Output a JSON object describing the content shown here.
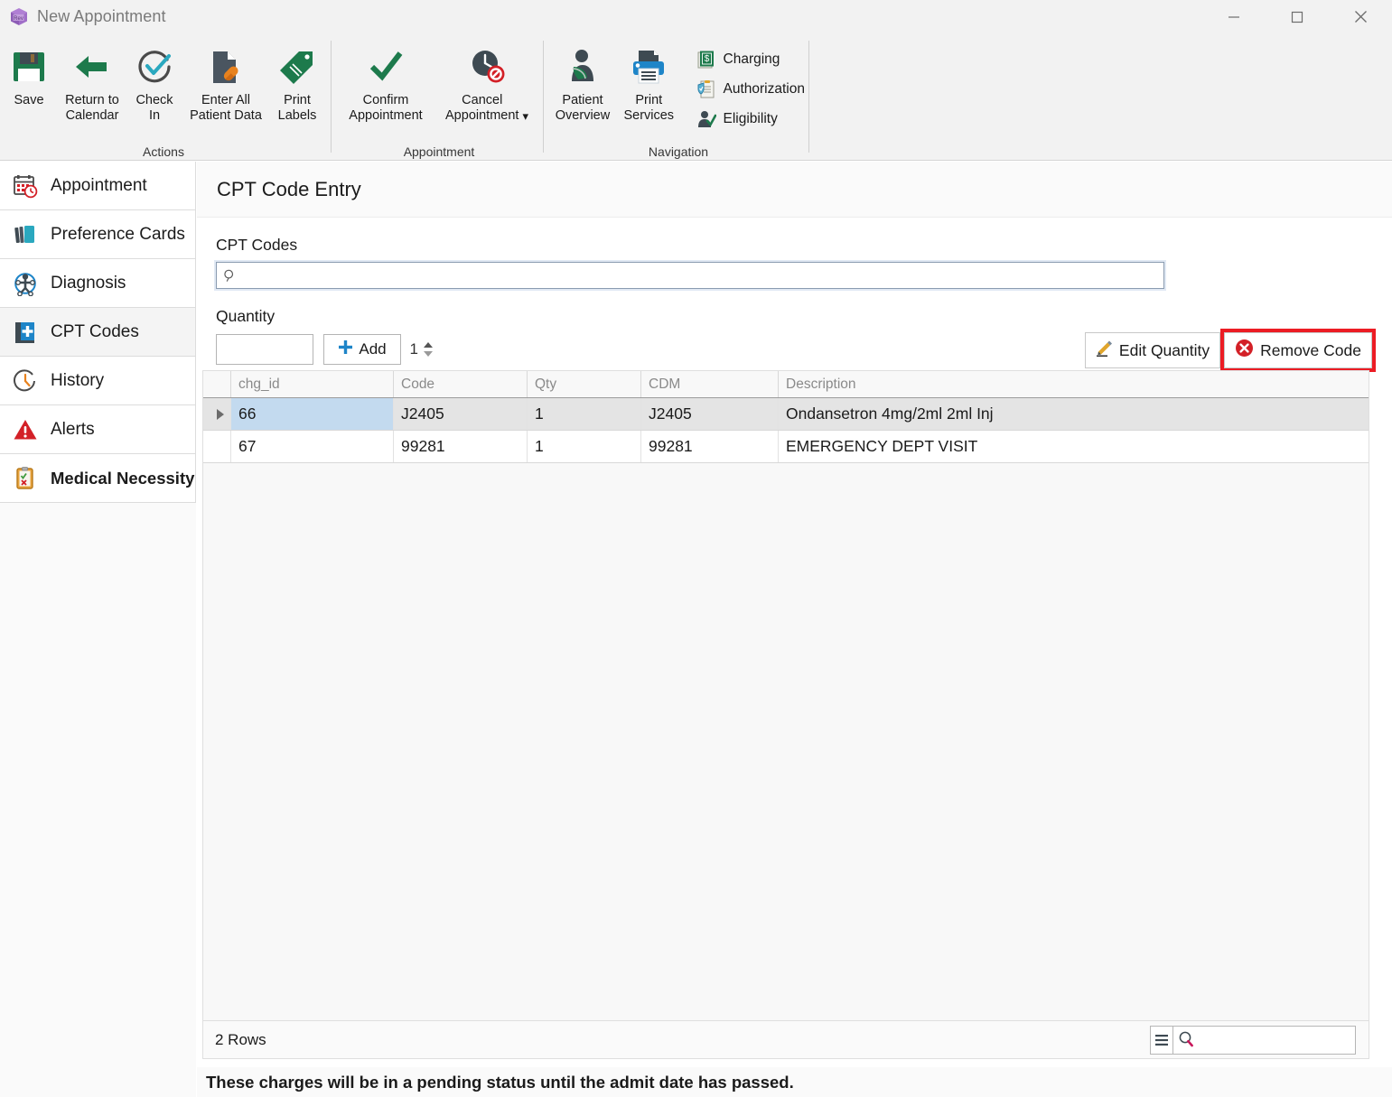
{
  "window": {
    "title": "New Appointment",
    "icon": "app-cube-icon",
    "controls": {
      "minimize": "minimize-icon",
      "maximize": "maximize-icon",
      "close": "close-icon"
    }
  },
  "ribbon": {
    "groups": [
      {
        "title": "Actions",
        "buttons": [
          {
            "label": "Save",
            "icon": "floppy-disk-save-icon"
          },
          {
            "label": "Return to\nCalendar",
            "icon": "left-arrow-icon"
          },
          {
            "label": "Check\nIn",
            "icon": "check-circle-icon"
          },
          {
            "label": "Enter All\nPatient Data",
            "icon": "document-pill-icon"
          },
          {
            "label": "Print\nLabels",
            "icon": "tag-label-icon"
          }
        ]
      },
      {
        "title": "Appointment",
        "buttons": [
          {
            "label": "Confirm\nAppointment",
            "icon": "green-checkmark-icon"
          },
          {
            "label": "Cancel\nAppointment",
            "icon": "clock-deny-icon",
            "has_dropdown": true
          }
        ]
      },
      {
        "title": "Navigation",
        "buttons": [
          {
            "label": "Patient\nOverview",
            "icon": "patient-sling-icon"
          },
          {
            "label": "Print\nServices",
            "icon": "printer-icon"
          }
        ],
        "small_buttons": [
          {
            "label": "Charging",
            "icon": "money-bill-icon"
          },
          {
            "label": "Authorization",
            "icon": "clipboard-shield-icon"
          },
          {
            "label": "Eligibility",
            "icon": "person-check-icon"
          }
        ]
      }
    ]
  },
  "sidebar": {
    "items": [
      {
        "label": "Appointment",
        "icon": "calendar-clock-icon",
        "active": false,
        "bold": false
      },
      {
        "label": "Preference Cards",
        "icon": "cards-icon",
        "active": false,
        "bold": false
      },
      {
        "label": "Diagnosis",
        "icon": "person-circle-icon",
        "active": false,
        "bold": false
      },
      {
        "label": "CPT Codes",
        "icon": "book-plus-icon",
        "active": true,
        "bold": false
      },
      {
        "label": "History",
        "icon": "clock-icon",
        "active": false,
        "bold": false
      },
      {
        "label": "Alerts",
        "icon": "warning-triangle-icon",
        "active": false,
        "bold": false
      },
      {
        "label": "Medical Necessity",
        "icon": "clipboard-check-x-icon",
        "active": false,
        "bold": true
      }
    ]
  },
  "main": {
    "page_title": "CPT Code Entry",
    "cpt_codes": {
      "label": "CPT Codes",
      "value": "",
      "placeholder": "",
      "icon": "search-magnifier-icon"
    },
    "quantity": {
      "label": "Quantity",
      "value": "1",
      "spinner_up": "spinner-up-icon",
      "spinner_down": "spinner-down-icon"
    },
    "add_button": {
      "label": "Add",
      "icon": "plus-icon"
    },
    "toolbar": {
      "edit_quantity": {
        "label": "Edit Quantity",
        "icon": "pencil-edit-icon"
      },
      "remove_code": {
        "label": "Remove Code",
        "icon": "red-x-circle-icon",
        "highlight_color": "#ec1c24"
      }
    },
    "grid": {
      "columns": [
        "chg_id",
        "Code",
        "Qty",
        "CDM",
        "Description"
      ],
      "rows": [
        {
          "chg_id": "66",
          "Code": "J2405",
          "Qty": "1",
          "CDM": "J2405",
          "Description": "Ondansetron 4mg/2ml 2ml Inj",
          "selected": true
        },
        {
          "chg_id": "67",
          "Code": "99281",
          "Qty": "1",
          "CDM": "99281",
          "Description": "EMERGENCY DEPT VISIT",
          "selected": false
        }
      ],
      "footer": {
        "row_count": "2 Rows",
        "menu_icon": "hamburger-menu-icon",
        "search_icon": "search-magnifier-icon",
        "search_value": "",
        "search_placeholder": ""
      }
    },
    "notice": "These charges will be in a pending status until the admit date has passed."
  },
  "colors": {
    "green": "#1d7a4c",
    "teal": "#2aa8bf",
    "blue": "#1e85c8",
    "red": "#d32027",
    "highlight_red": "#ec1c24",
    "selection_blue": "#c3daef",
    "row_selected": "#e4e4e4"
  }
}
